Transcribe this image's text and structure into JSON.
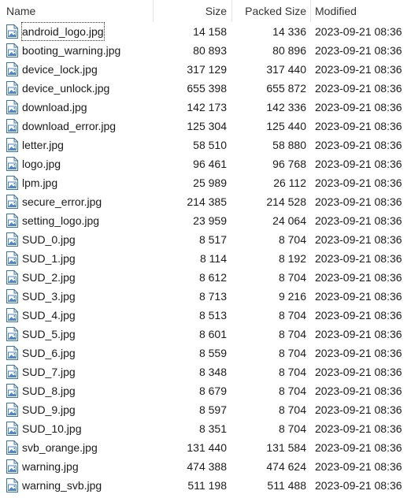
{
  "columns": {
    "name": "Name",
    "size": "Size",
    "packed_size": "Packed Size",
    "modified": "Modified"
  },
  "icon": "image-file-icon",
  "colors": {
    "icon_border": "#3a6fb0",
    "icon_fill": "#ffffff",
    "icon_picture": "#4a86c8",
    "header_separator": "#e5e5e5"
  },
  "files": [
    {
      "name": "android_logo.jpg",
      "size": "14 158",
      "packed": "14 336",
      "modified": "2023-09-21 08:36"
    },
    {
      "name": "booting_warning.jpg",
      "size": "80 893",
      "packed": "80 896",
      "modified": "2023-09-21 08:36"
    },
    {
      "name": "device_lock.jpg",
      "size": "317 129",
      "packed": "317 440",
      "modified": "2023-09-21 08:36"
    },
    {
      "name": "device_unlock.jpg",
      "size": "655 398",
      "packed": "655 872",
      "modified": "2023-09-21 08:36"
    },
    {
      "name": "download.jpg",
      "size": "142 173",
      "packed": "142 336",
      "modified": "2023-09-21 08:36"
    },
    {
      "name": "download_error.jpg",
      "size": "125 304",
      "packed": "125 440",
      "modified": "2023-09-21 08:36"
    },
    {
      "name": "letter.jpg",
      "size": "58 510",
      "packed": "58 880",
      "modified": "2023-09-21 08:36"
    },
    {
      "name": "logo.jpg",
      "size": "96 461",
      "packed": "96 768",
      "modified": "2023-09-21 08:36"
    },
    {
      "name": "lpm.jpg",
      "size": "25 989",
      "packed": "26 112",
      "modified": "2023-09-21 08:36"
    },
    {
      "name": "secure_error.jpg",
      "size": "214 385",
      "packed": "214 528",
      "modified": "2023-09-21 08:36"
    },
    {
      "name": "setting_logo.jpg",
      "size": "23 959",
      "packed": "24 064",
      "modified": "2023-09-21 08:36"
    },
    {
      "name": "SUD_0.jpg",
      "size": "8 517",
      "packed": "8 704",
      "modified": "2023-09-21 08:36"
    },
    {
      "name": "SUD_1.jpg",
      "size": "8 114",
      "packed": "8 192",
      "modified": "2023-09-21 08:36"
    },
    {
      "name": "SUD_2.jpg",
      "size": "8 612",
      "packed": "8 704",
      "modified": "2023-09-21 08:36"
    },
    {
      "name": "SUD_3.jpg",
      "size": "8 713",
      "packed": "9 216",
      "modified": "2023-09-21 08:36"
    },
    {
      "name": "SUD_4.jpg",
      "size": "8 513",
      "packed": "8 704",
      "modified": "2023-09-21 08:36"
    },
    {
      "name": "SUD_5.jpg",
      "size": "8 601",
      "packed": "8 704",
      "modified": "2023-09-21 08:36"
    },
    {
      "name": "SUD_6.jpg",
      "size": "8 559",
      "packed": "8 704",
      "modified": "2023-09-21 08:36"
    },
    {
      "name": "SUD_7.jpg",
      "size": "8 348",
      "packed": "8 704",
      "modified": "2023-09-21 08:36"
    },
    {
      "name": "SUD_8.jpg",
      "size": "8 679",
      "packed": "8 704",
      "modified": "2023-09-21 08:36"
    },
    {
      "name": "SUD_9.jpg",
      "size": "8 597",
      "packed": "8 704",
      "modified": "2023-09-21 08:36"
    },
    {
      "name": "SUD_10.jpg",
      "size": "8 351",
      "packed": "8 704",
      "modified": "2023-09-21 08:36"
    },
    {
      "name": "svb_orange.jpg",
      "size": "131 440",
      "packed": "131 584",
      "modified": "2023-09-21 08:36"
    },
    {
      "name": "warning.jpg",
      "size": "474 388",
      "packed": "474 624",
      "modified": "2023-09-21 08:36"
    },
    {
      "name": "warning_svb.jpg",
      "size": "511 198",
      "packed": "511 488",
      "modified": "2023-09-21 08:36"
    }
  ]
}
